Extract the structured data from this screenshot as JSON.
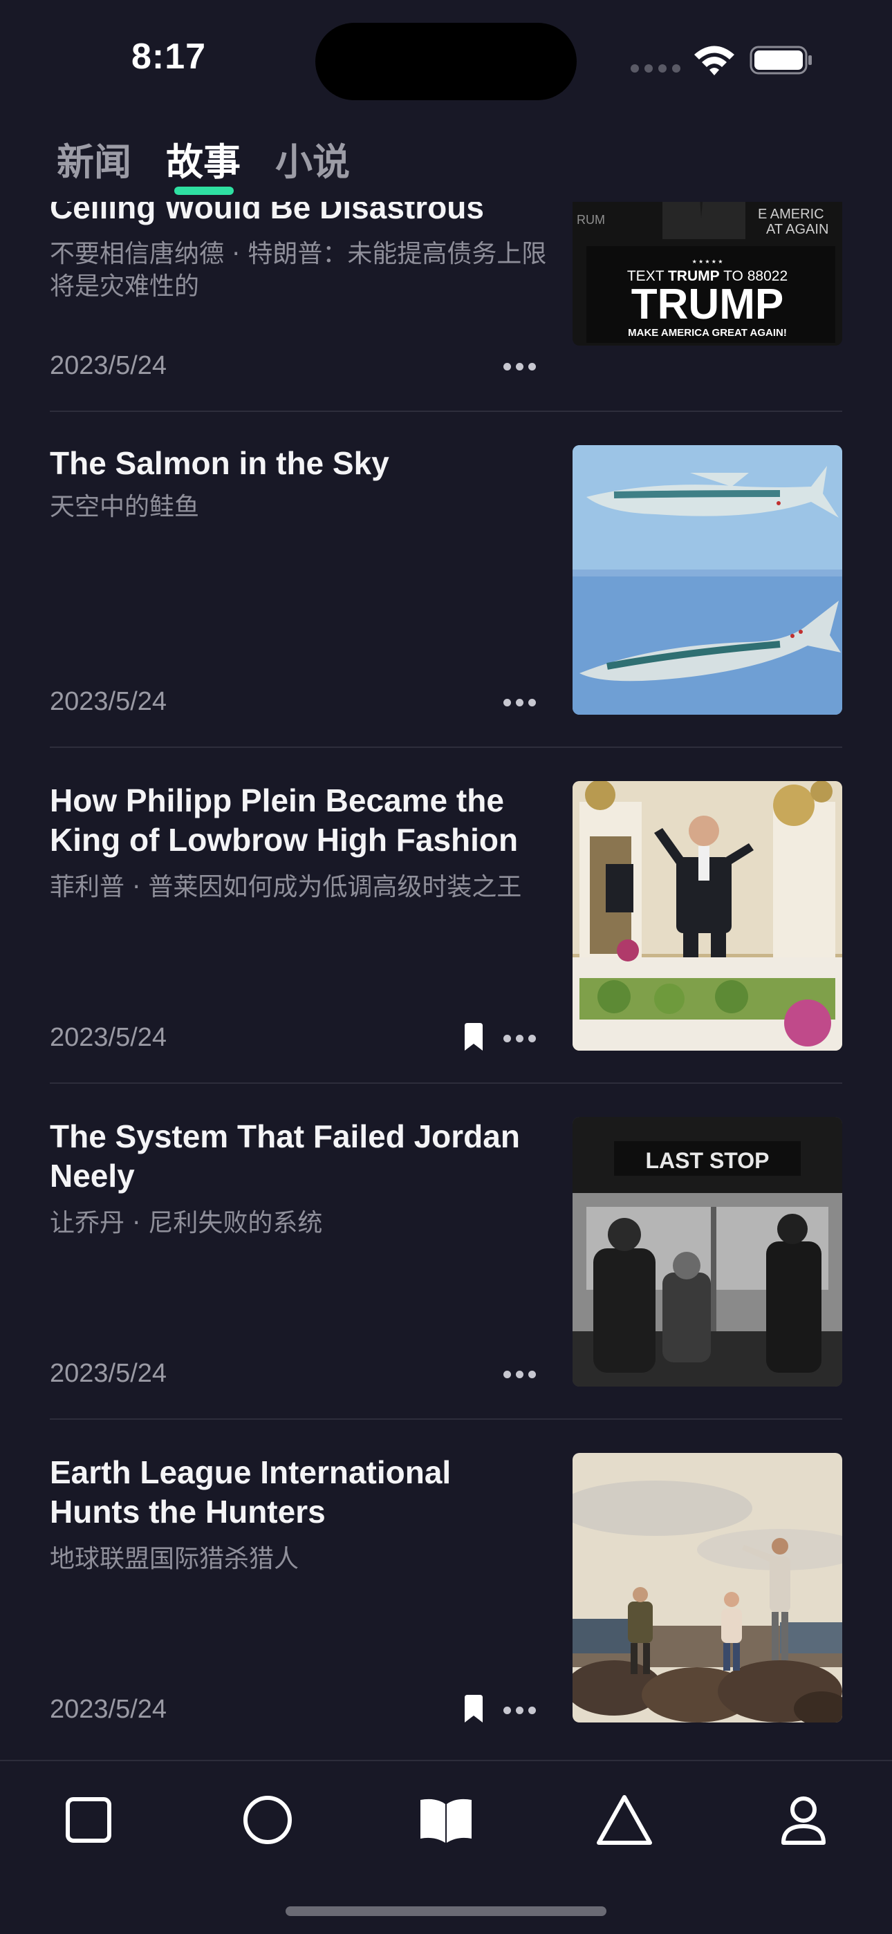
{
  "status": {
    "time": "8:17"
  },
  "tabs": [
    {
      "label": "新闻",
      "active": false
    },
    {
      "label": "故事",
      "active": true
    },
    {
      "label": "小说",
      "active": false
    }
  ],
  "stories": [
    {
      "title": "Ceiling Would Be Disastrous",
      "subtitle": "不要相信唐纳德 · 特朗普：未能提高债务上限将是灾难性的",
      "date": "2023/5/24",
      "bookmarked": false,
      "thumb_text": {
        "line1_pre": "TEXT ",
        "line1_bold": "TRUMP",
        "line1_post": " TO 88022",
        "line2": "TRUMP",
        "line3": "MAKE AMERICA GREAT AGAIN!",
        "side": "E AMERIC",
        "side2": "AT AGAIN",
        "left": "RUM"
      }
    },
    {
      "title": "The Salmon in the Sky",
      "subtitle": "天空中的鲑鱼",
      "date": "2023/5/24",
      "bookmarked": false
    },
    {
      "title": "How Philipp Plein Became the King of Lowbrow High Fashion",
      "subtitle": "菲利普 · 普莱因如何成为低调高级时装之王",
      "date": "2023/5/24",
      "bookmarked": true
    },
    {
      "title": "The System That Failed Jordan Neely",
      "subtitle": "让乔丹 · 尼利失败的系统",
      "date": "2023/5/24",
      "bookmarked": false,
      "thumb_text": {
        "sign": "LAST STOP"
      }
    },
    {
      "title": "Earth League International Hunts the Hunters",
      "subtitle": "地球联盟国际猎杀猎人",
      "date": "2023/5/24",
      "bookmarked": true
    }
  ],
  "bottom_nav": [
    {
      "icon": "square-icon"
    },
    {
      "icon": "circle-icon"
    },
    {
      "icon": "book-icon"
    },
    {
      "icon": "triangle-icon"
    },
    {
      "icon": "person-icon"
    }
  ],
  "colors": {
    "background": "#181826",
    "accent": "#2fe0a2",
    "divider": "#2d2d3b"
  }
}
